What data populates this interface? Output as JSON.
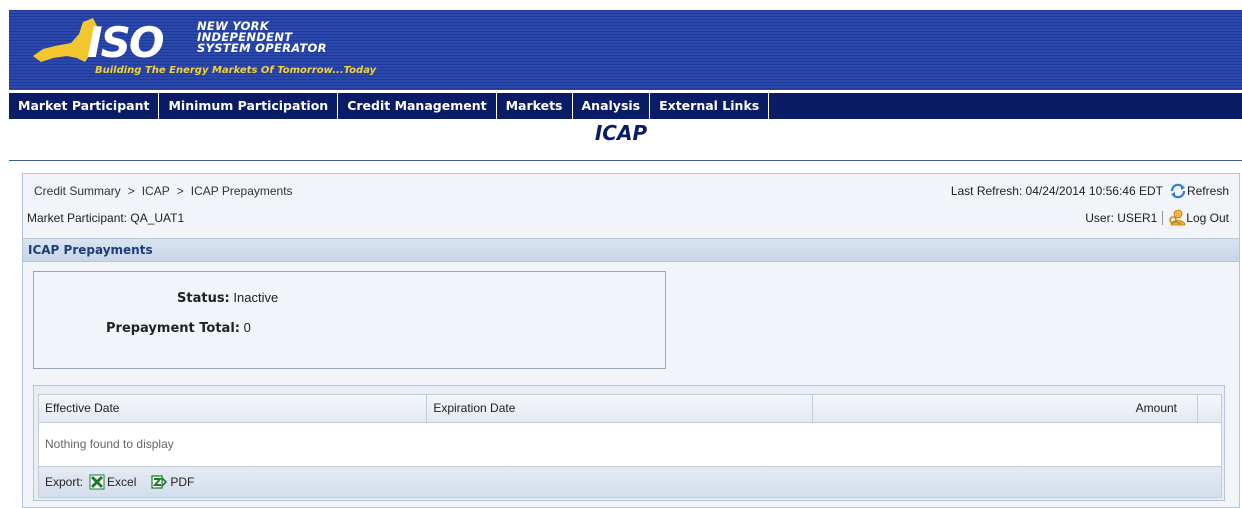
{
  "brand": {
    "logo_text": "ISO",
    "name_lines": [
      "NEW YORK",
      "INDEPENDENT",
      "SYSTEM OPERATOR"
    ],
    "tagline": "Building The Energy Markets Of Tomorrow...Today",
    "colors": {
      "banner": "#2b48ad",
      "tagline": "#f2d23c",
      "state_shape": "#f2c62e"
    }
  },
  "nav": {
    "items": [
      "Market Participant",
      "Minimum Participation",
      "Credit Management",
      "Markets",
      "Analysis",
      "External Links"
    ],
    "color": "#0b1c66"
  },
  "page_title": "ICAP",
  "breadcrumb": [
    "Credit Summary",
    "ICAP",
    "ICAP Prepayments"
  ],
  "breadcrumb_separator": ">",
  "market_participant": "Market Participant: QA_UAT1",
  "last_refresh": "Last Refresh: 04/24/2014 10:56:46 EDT",
  "refresh_label": "Refresh",
  "user": "User: USER1",
  "logout_label": "Log Out",
  "section_title": "ICAP Prepayments",
  "summary": {
    "status_label": "Status:",
    "status_value": "Inactive",
    "total_label": "Prepayment Total:",
    "total_value": "0"
  },
  "table": {
    "columns": [
      "Effective Date",
      "Expiration Date",
      "Amount"
    ],
    "rows": [],
    "empty_message": "Nothing found to display"
  },
  "export": {
    "label": "Export:",
    "excel_label": "Excel",
    "pdf_label": "PDF"
  },
  "icons": {
    "refresh": "refresh-icon",
    "logout": "keys-user-icon",
    "excel": "excel-icon",
    "pdf": "pdf-icon"
  }
}
